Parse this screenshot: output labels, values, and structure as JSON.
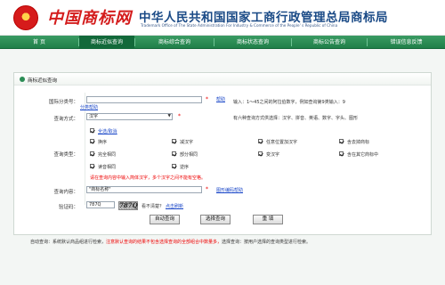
{
  "header": {
    "emblem_text": "★",
    "logo": "中国商标网",
    "org_cn": "中华人民共和国国家工商行政管理总局商标局",
    "org_en": "Trademark Office of The State Administration For Industry & Commerce of the People' s Republic of China"
  },
  "nav": {
    "items": [
      "首 页",
      "商标近似查询",
      "商标综合查询",
      "商标状态查询",
      "商标公告查询",
      "错误信息反馈"
    ],
    "active_index": 1
  },
  "panel": {
    "title": "商标近似查询",
    "class_label": "国际分类号：",
    "class_value": "",
    "class_link": "帮助",
    "class_help_link": "分类帮助",
    "class_note": "输入：1～45之间的阿拉伯数字，例如查询第9类输入：9",
    "method_label": "查询方式：",
    "method_value": "汉字",
    "method_note": "有六种查询方式供选择：汉字、拼音、英语、数字、字头、图形",
    "type_label": "查询类型：",
    "select_all": "全选/取消",
    "types": [
      [
        "换序",
        "减汉字",
        "任意位置加汉字",
        "含去掉商标"
      ],
      [
        "完全相同",
        "部分相同",
        "变汉字",
        "含在其它商标中"
      ],
      [
        "读音相同",
        "逆序"
      ]
    ],
    "type_warning": "请在查询内容中输入简体汉字，多个汉字之间不能有空格。",
    "content_label": "查询内容：",
    "content_value": "\"商标名称\"",
    "content_link": "图形编码帮助",
    "captcha_label": "验证码：",
    "captcha_value": "787Q",
    "captcha_image_text": "787Q",
    "captcha_hint": "看不清楚？",
    "captcha_refresh": "点击刷新",
    "buttons": [
      "自动查询",
      "选择查询",
      "重 填"
    ]
  },
  "footer": {
    "prefix": "自动查询：系统默认商品组进行检索，",
    "highlight": "注意默认查询的结果不包含选择查询的全部组合中数量多，",
    "suffix": "选择查询：按用户选择的查询类型进行检索。"
  },
  "colors": {
    "nav_green": "#1f7f48",
    "logo_red": "#d41c1c",
    "title_blue": "#1a4a86",
    "warning_red": "#ee0000",
    "link_blue": "#1a47c8"
  }
}
